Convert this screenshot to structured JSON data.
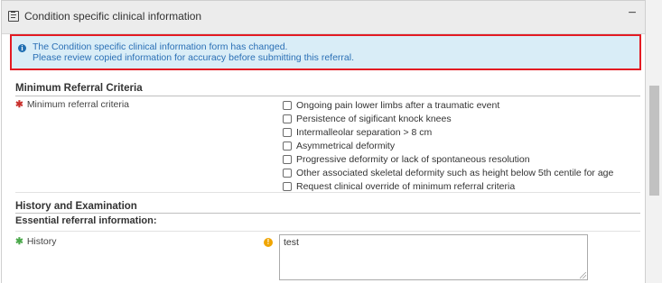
{
  "panel": {
    "title": "Condition specific clinical information",
    "collapse_symbol": "−",
    "header_icon": "form-icon"
  },
  "alert": {
    "icon": "info-icon",
    "line1": "The Condition specific clinical information form has changed.",
    "line2": "Please review copied information for accuracy before submitting this referral.",
    "highlight_color": "#e31b23",
    "background": "#d9edf7"
  },
  "min_criteria": {
    "section_title": "Minimum Referral Criteria",
    "field_label": "Minimum referral criteria",
    "required_marker": "✱",
    "options": [
      {
        "label": "Ongoing pain lower limbs after a traumatic event",
        "checked": false
      },
      {
        "label": "Persistence of sigificant knock knees",
        "checked": false
      },
      {
        "label": "Intermalleolar separation > 8 cm",
        "checked": false
      },
      {
        "label": "Asymmetrical deformity",
        "checked": false
      },
      {
        "label": "Progressive deformity or lack of spontaneous resolution",
        "checked": false
      },
      {
        "label": "Other associated skeletal deformity such as height below 5th centile for age",
        "checked": false
      },
      {
        "label": "Request clinical override of minimum referral criteria",
        "checked": false
      }
    ]
  },
  "history_exam": {
    "section_title": "History and Examination",
    "subsection_title": "Essential referral information:",
    "history_label": "History",
    "required_marker": "✱",
    "warning_icon": "warning-icon",
    "history_value": "test"
  }
}
